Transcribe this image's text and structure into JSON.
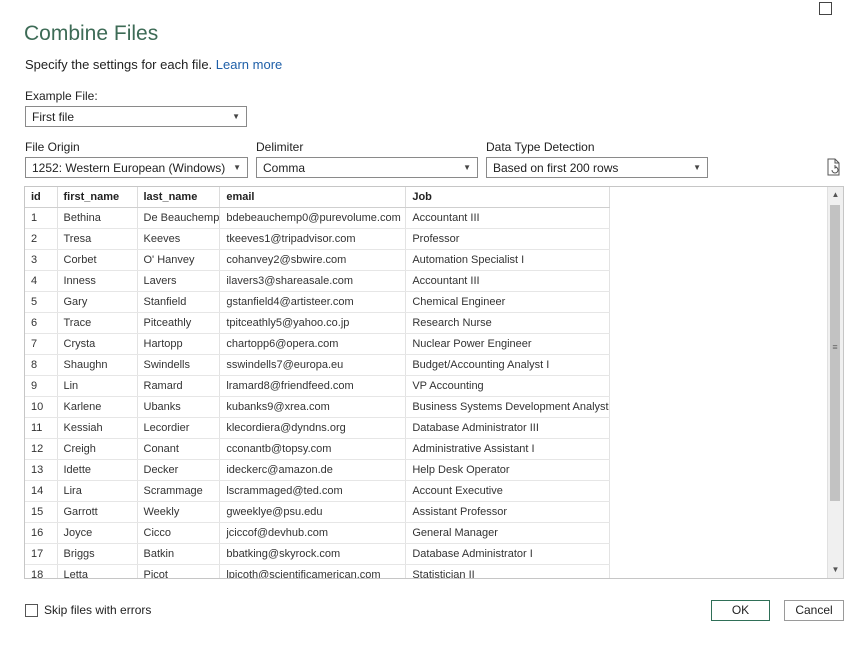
{
  "dialog": {
    "title": "Combine Files",
    "subtitle": "Specify the settings for each file.",
    "learn_more": "Learn more"
  },
  "example_file": {
    "label": "Example File:",
    "value": "First file"
  },
  "file_origin": {
    "label": "File Origin",
    "value": "1252: Western European (Windows)"
  },
  "delimiter": {
    "label": "Delimiter",
    "value": "Comma"
  },
  "data_type_detection": {
    "label": "Data Type Detection",
    "value": "Based on first 200 rows"
  },
  "preview": {
    "columns": [
      "id",
      "first_name",
      "last_name",
      "email",
      "Job"
    ],
    "rows": [
      [
        "1",
        "Bethina",
        "De Beauchemp",
        "bdebeauchemp0@purevolume.com",
        "Accountant III"
      ],
      [
        "2",
        "Tresa",
        "Keeves",
        "tkeeves1@tripadvisor.com",
        "Professor"
      ],
      [
        "3",
        "Corbet",
        "O' Hanvey",
        "cohanvey2@sbwire.com",
        "Automation Specialist I"
      ],
      [
        "4",
        "Inness",
        "Lavers",
        "ilavers3@shareasale.com",
        "Accountant III"
      ],
      [
        "5",
        "Gary",
        "Stanfield",
        "gstanfield4@artisteer.com",
        "Chemical Engineer"
      ],
      [
        "6",
        "Trace",
        "Pitceathly",
        "tpitceathly5@yahoo.co.jp",
        "Research Nurse"
      ],
      [
        "7",
        "Crysta",
        "Hartopp",
        "chartopp6@opera.com",
        "Nuclear Power Engineer"
      ],
      [
        "8",
        "Shaughn",
        "Swindells",
        "sswindells7@europa.eu",
        "Budget/Accounting Analyst I"
      ],
      [
        "9",
        "Lin",
        "Ramard",
        "lramard8@friendfeed.com",
        "VP Accounting"
      ],
      [
        "10",
        "Karlene",
        "Ubanks",
        "kubanks9@xrea.com",
        "Business Systems Development Analyst"
      ],
      [
        "11",
        "Kessiah",
        "Lecordier",
        "klecordiera@dyndns.org",
        "Database Administrator III"
      ],
      [
        "12",
        "Creigh",
        "Conant",
        "cconantb@topsy.com",
        "Administrative Assistant I"
      ],
      [
        "13",
        "Idette",
        "Decker",
        "ideckerc@amazon.de",
        "Help Desk Operator"
      ],
      [
        "14",
        "Lira",
        "Scrammage",
        "lscrammaged@ted.com",
        "Account Executive"
      ],
      [
        "15",
        "Garrott",
        "Weekly",
        "gweeklye@psu.edu",
        "Assistant Professor"
      ],
      [
        "16",
        "Joyce",
        "Cicco",
        "jciccof@devhub.com",
        "General Manager"
      ],
      [
        "17",
        "Briggs",
        "Batkin",
        "bbatking@skyrock.com",
        "Database Administrator I"
      ],
      [
        "18",
        "Letta",
        "Picot",
        "lpicoth@scientificamerican.com",
        "Statistician II"
      ]
    ]
  },
  "footer": {
    "skip_label": "Skip files with errors",
    "ok": "OK",
    "cancel": "Cancel"
  }
}
